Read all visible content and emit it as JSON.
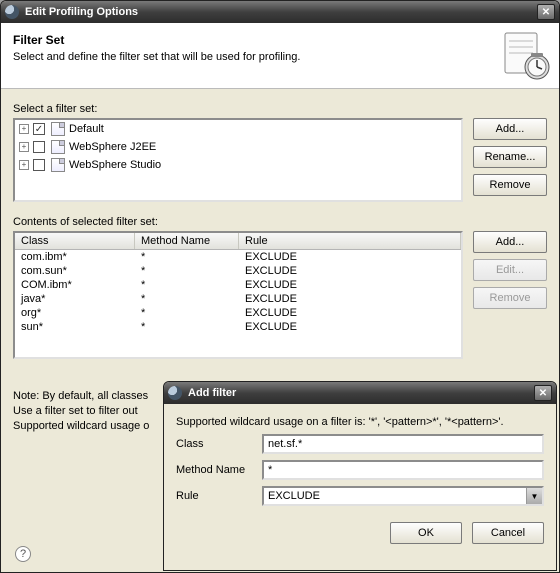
{
  "parent": {
    "title": "Edit Profiling Options",
    "banner_heading": "Filter Set",
    "banner_text": "Select and define the filter set that will be used for profiling.",
    "select_label": "Select a filter set:",
    "filter_sets": [
      {
        "label": "Default",
        "checked": true
      },
      {
        "label": "WebSphere J2EE",
        "checked": false
      },
      {
        "label": "WebSphere Studio",
        "checked": false
      }
    ],
    "top_buttons": {
      "add": "Add...",
      "rename": "Rename...",
      "remove": "Remove"
    },
    "contents_label": "Contents of selected filter set:",
    "columns": {
      "class": "Class",
      "method": "Method Name",
      "rule": "Rule"
    },
    "rows": [
      {
        "class": "com.ibm*",
        "method": "*",
        "rule": "EXCLUDE"
      },
      {
        "class": "com.sun*",
        "method": "*",
        "rule": "EXCLUDE"
      },
      {
        "class": "COM.ibm*",
        "method": "*",
        "rule": "EXCLUDE"
      },
      {
        "class": "java*",
        "method": "*",
        "rule": "EXCLUDE"
      },
      {
        "class": "org*",
        "method": "*",
        "rule": "EXCLUDE"
      },
      {
        "class": "sun*",
        "method": "*",
        "rule": "EXCLUDE"
      }
    ],
    "row_buttons": {
      "add": "Add...",
      "edit": "Edit...",
      "remove": "Remove"
    },
    "notes": [
      "Note: By default, all classes",
      "Use a filter set to filter out",
      "Supported wildcard usage o"
    ]
  },
  "child": {
    "title": "Add filter",
    "hint": "Supported wildcard usage on a filter is: '*', '<pattern>*', '*<pattern>'.",
    "labels": {
      "class": "Class",
      "method": "Method Name",
      "rule": "Rule"
    },
    "values": {
      "class": "net.sf.*",
      "method": "*",
      "rule": "EXCLUDE"
    },
    "buttons": {
      "ok": "OK",
      "cancel": "Cancel"
    }
  }
}
